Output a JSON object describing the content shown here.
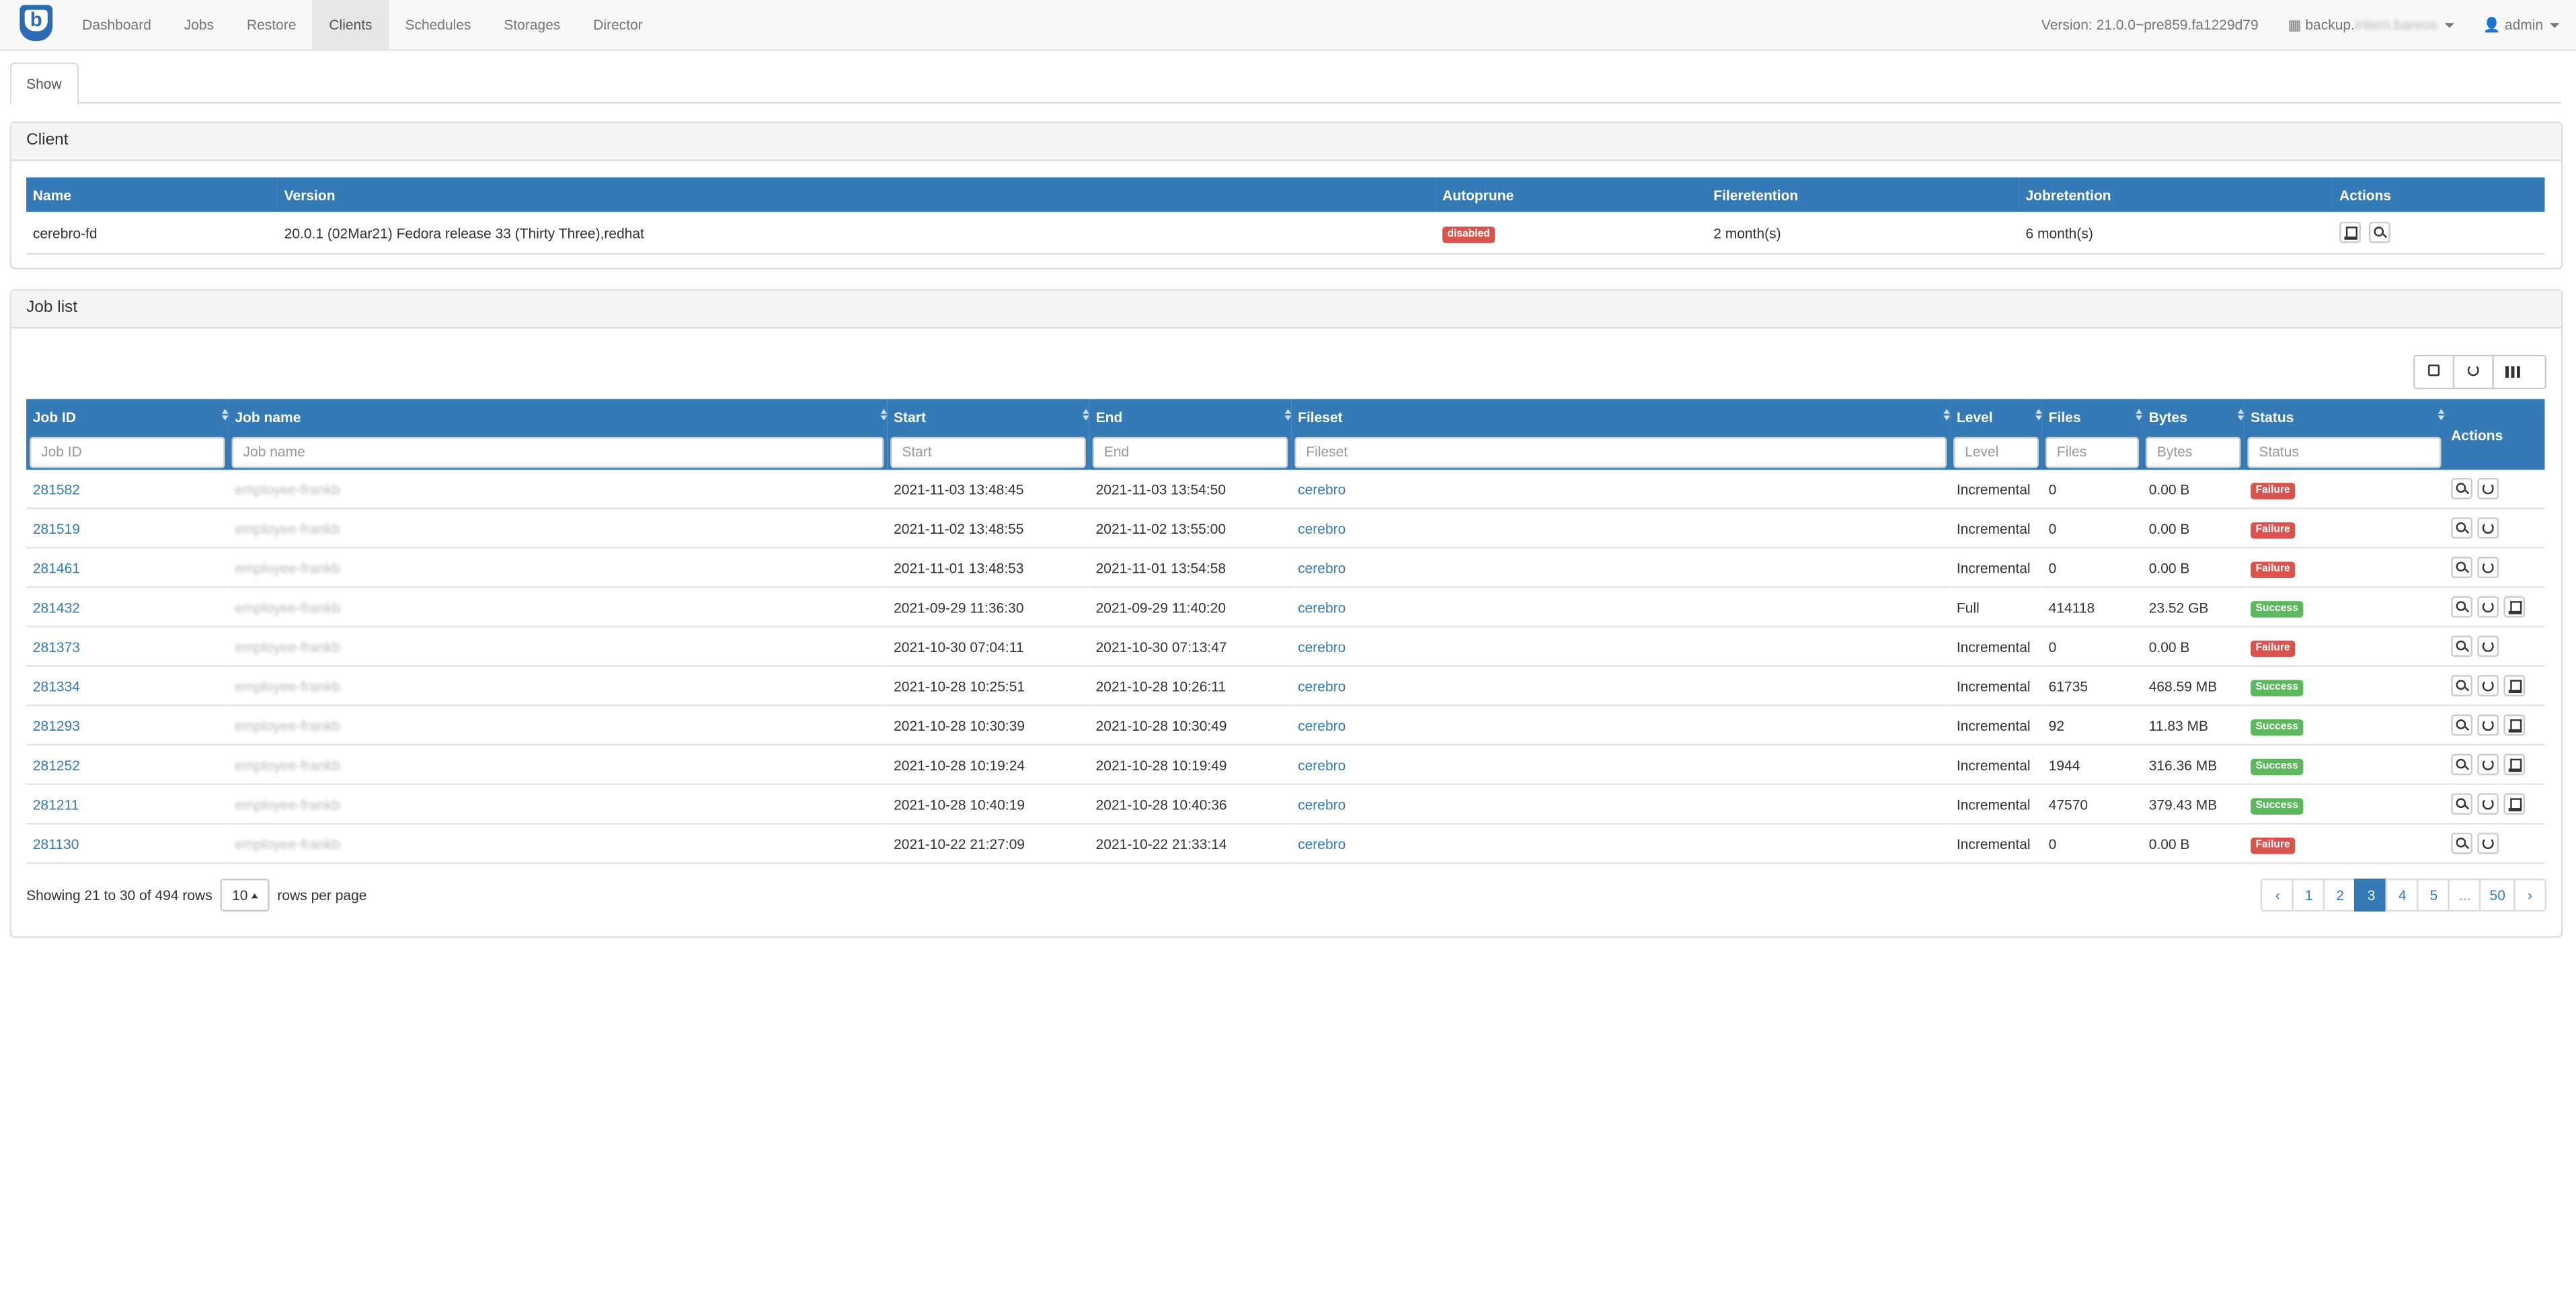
{
  "nav": {
    "logo_letter": "b",
    "items": [
      {
        "label": "Dashboard",
        "active": false
      },
      {
        "label": "Jobs",
        "active": false
      },
      {
        "label": "Restore",
        "active": false
      },
      {
        "label": "Clients",
        "active": true
      },
      {
        "label": "Schedules",
        "active": false
      },
      {
        "label": "Storages",
        "active": false
      },
      {
        "label": "Director",
        "active": false
      }
    ],
    "version": "Version: 21.0.0~pre859.fa1229d79",
    "director_prefix": "backup.",
    "director_blurred": "intern.bareos",
    "user": "admin"
  },
  "tabs": {
    "show": "Show"
  },
  "client_panel": {
    "title": "Client",
    "headers": [
      "Name",
      "Version",
      "Autoprune",
      "Fileretention",
      "Jobretention",
      "Actions"
    ],
    "row": {
      "name": "cerebro-fd",
      "version": "20.0.1 (02Mar21) Fedora release 33 (Thirty Three),redhat",
      "autoprune": "disabled",
      "fileretention": "2 month(s)",
      "jobretention": "6 month(s)"
    }
  },
  "job_panel": {
    "title": "Job list",
    "headers": [
      "Job ID",
      "Job name",
      "Start",
      "End",
      "Fileset",
      "Level",
      "Files",
      "Bytes",
      "Status",
      "Actions"
    ],
    "filters": [
      "Job ID",
      "Job name",
      "Start",
      "End",
      "Fileset",
      "Level",
      "Files",
      "Bytes",
      "Status"
    ],
    "jobs": [
      {
        "id": "281582",
        "name": "employee-frankb",
        "start": "2021-11-03 13:48:45",
        "end": "2021-11-03 13:54:50",
        "fileset": "cerebro",
        "level": "Incremental",
        "files": "0",
        "bytes": "0.00 B",
        "status": "Failure"
      },
      {
        "id": "281519",
        "name": "employee-frankb",
        "start": "2021-11-02 13:48:55",
        "end": "2021-11-02 13:55:00",
        "fileset": "cerebro",
        "level": "Incremental",
        "files": "0",
        "bytes": "0.00 B",
        "status": "Failure"
      },
      {
        "id": "281461",
        "name": "employee-frankb",
        "start": "2021-11-01 13:48:53",
        "end": "2021-11-01 13:54:58",
        "fileset": "cerebro",
        "level": "Incremental",
        "files": "0",
        "bytes": "0.00 B",
        "status": "Failure"
      },
      {
        "id": "281432",
        "name": "employee-frankb",
        "start": "2021-09-29 11:36:30",
        "end": "2021-09-29 11:40:20",
        "fileset": "cerebro",
        "level": "Full",
        "files": "414118",
        "bytes": "23.52 GB",
        "status": "Success"
      },
      {
        "id": "281373",
        "name": "employee-frankb",
        "start": "2021-10-30 07:04:11",
        "end": "2021-10-30 07:13:47",
        "fileset": "cerebro",
        "level": "Incremental",
        "files": "0",
        "bytes": "0.00 B",
        "status": "Failure"
      },
      {
        "id": "281334",
        "name": "employee-frankb",
        "start": "2021-10-28 10:25:51",
        "end": "2021-10-28 10:26:11",
        "fileset": "cerebro",
        "level": "Incremental",
        "files": "61735",
        "bytes": "468.59 MB",
        "status": "Success"
      },
      {
        "id": "281293",
        "name": "employee-frankb",
        "start": "2021-10-28 10:30:39",
        "end": "2021-10-28 10:30:49",
        "fileset": "cerebro",
        "level": "Incremental",
        "files": "92",
        "bytes": "11.83 MB",
        "status": "Success"
      },
      {
        "id": "281252",
        "name": "employee-frankb",
        "start": "2021-10-28 10:19:24",
        "end": "2021-10-28 10:19:49",
        "fileset": "cerebro",
        "level": "Incremental",
        "files": "1944",
        "bytes": "316.36 MB",
        "status": "Success"
      },
      {
        "id": "281211",
        "name": "employee-frankb",
        "start": "2021-10-28 10:40:19",
        "end": "2021-10-28 10:40:36",
        "fileset": "cerebro",
        "level": "Incremental",
        "files": "47570",
        "bytes": "379.43 MB",
        "status": "Success"
      },
      {
        "id": "281130",
        "name": "employee-frankb",
        "start": "2021-10-22 21:27:09",
        "end": "2021-10-22 21:33:14",
        "fileset": "cerebro",
        "level": "Incremental",
        "files": "0",
        "bytes": "0.00 B",
        "status": "Failure"
      }
    ],
    "footer": {
      "showing": "Showing 21 to 30 of 494 rows",
      "per_page_value": "10",
      "per_page_suffix": "rows per page"
    },
    "pagination": [
      "‹",
      "1",
      "2",
      "3",
      "4",
      "5",
      "...",
      "50",
      "›"
    ],
    "active_page": "3"
  },
  "colors": {
    "primary": "#337ab7",
    "failure": "#d9534f",
    "success": "#5cb85c"
  },
  "icons": {
    "job_actions": [
      "search-icon",
      "rerun-icon",
      "restore-icon"
    ],
    "client_actions": [
      "restore-icon",
      "search-icon"
    ]
  }
}
